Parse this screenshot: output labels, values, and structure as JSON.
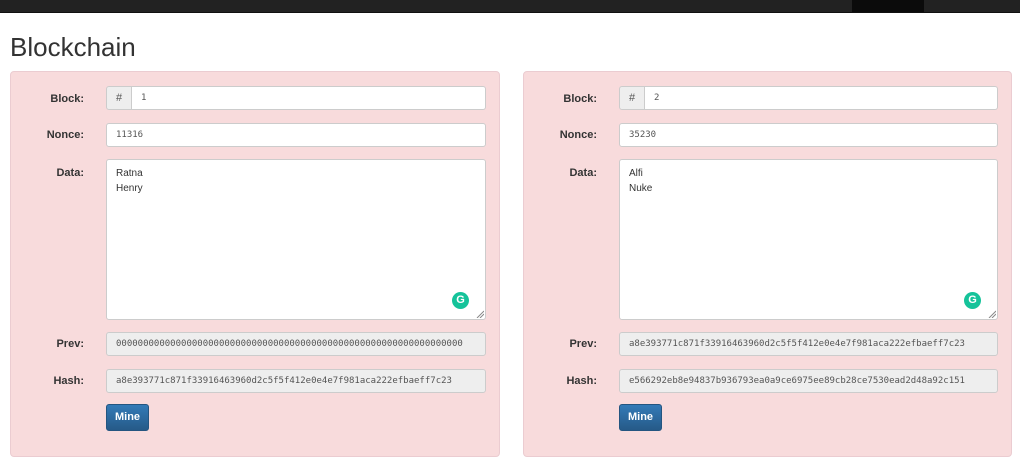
{
  "page": {
    "title": "Blockchain"
  },
  "labels": {
    "block": "Block:",
    "nonce": "Nonce:",
    "data": "Data:",
    "prev": "Prev:",
    "hash": "Hash:",
    "block_prefix": "#",
    "mine": "Mine"
  },
  "blocks": [
    {
      "number": "1",
      "nonce": "11316",
      "data_lines": [
        "Ratna",
        "Henry"
      ],
      "prev": "0000000000000000000000000000000000000000000000000000000000000000",
      "hash": "a8e393771c871f33916463960d2c5f5f412e0e4e7f981aca222efbaeff7c23"
    },
    {
      "number": "2",
      "nonce": "35230",
      "data_lines": [
        "Alfi",
        "Nuke"
      ],
      "prev": "a8e393771c871f33916463960d2c5f5f412e0e4e7f981aca222efbaeff7c23",
      "hash": "e566292eb8e94837b936793ea0a9ce6975ee89cb28ce7530ead2d48a92c151"
    }
  ],
  "colors": {
    "card_background": "#f8dbdc",
    "card_border": "#ebccd1",
    "button_primary": "#337ab7",
    "grammarly_green": "#15c39a"
  },
  "icons": {
    "grammarly": "grammarly-icon",
    "resize": "resize-handle-icon"
  }
}
